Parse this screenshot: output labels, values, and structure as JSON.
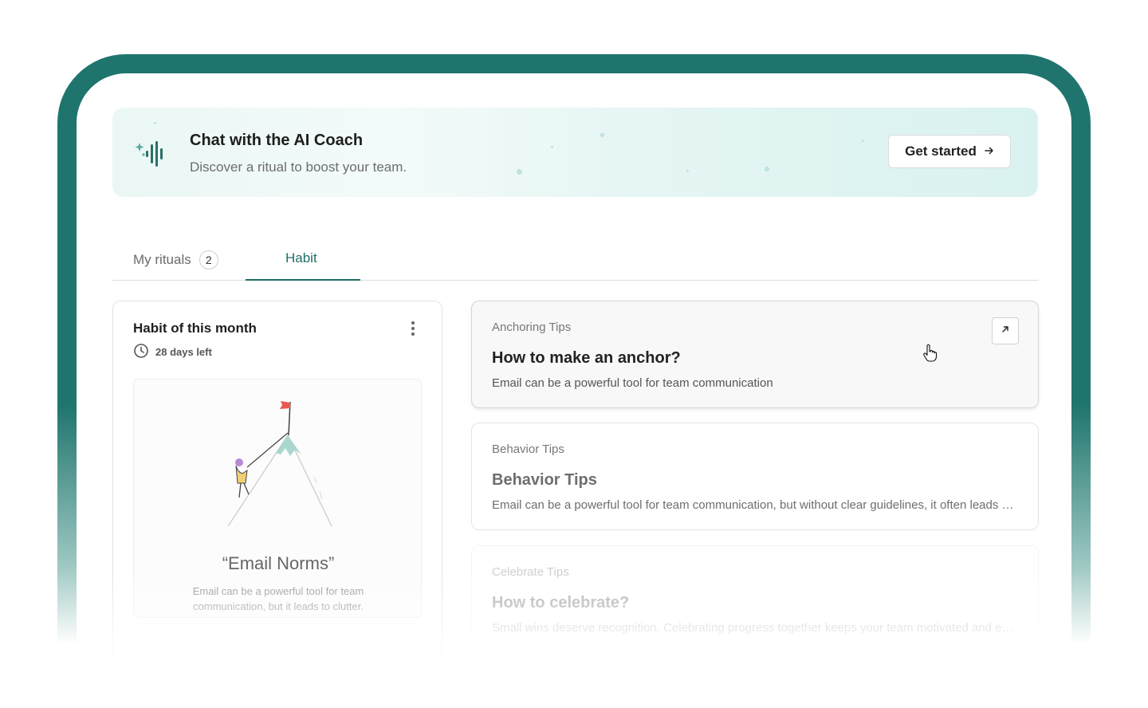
{
  "banner": {
    "title": "Chat with the AI Coach",
    "subtitle": "Discover a ritual to boost your team.",
    "button_label": "Get started",
    "icon": "sparkle-voice-icon",
    "button_icon": "arrow-right-icon"
  },
  "tabs": {
    "my_rituals": {
      "label": "My rituals",
      "count": "2"
    },
    "habit": {
      "label": "Habit",
      "active": true
    }
  },
  "habit": {
    "title": "Habit of this month",
    "days_left": "28 days left",
    "quote": "“Email Norms”",
    "description": "Email can be a powerful tool for team communication, but it leads to clutter."
  },
  "tips": [
    {
      "category": "Anchoring Tips",
      "title": "How to make an anchor?",
      "description": "Email can be a powerful tool for team communication"
    },
    {
      "category": "Behavior Tips",
      "title": "Behavior Tips",
      "description": "Email can be a powerful tool for team communication, but without clear guidelines, it often leads to clutter"
    },
    {
      "category": "Celebrate Tips",
      "title": "How to celebrate?",
      "description": "Small wins deserve recognition. Celebrating progress together keeps your team motivated and engaged"
    }
  ],
  "colors": {
    "accent": "#1f6f67",
    "frame": "#1f756d",
    "banner_bg": "#e6f6f4"
  }
}
